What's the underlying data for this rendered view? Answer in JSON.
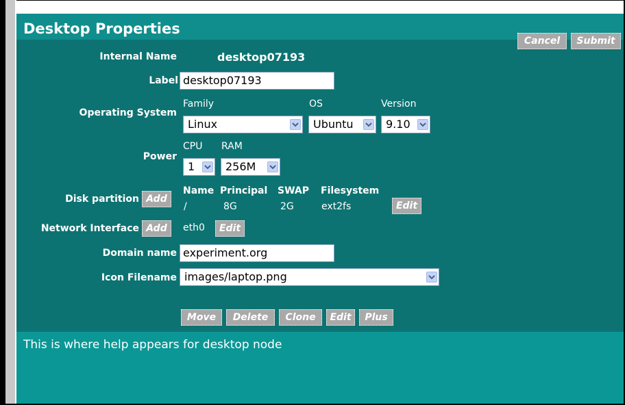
{
  "window": {
    "title": "Desktop Properties"
  },
  "toolbar": {
    "cancel_label": "Cancel",
    "submit_label": "Submit"
  },
  "fields": {
    "internal_name": {
      "label": "Internal Name",
      "value": "desktop07193"
    },
    "label": {
      "label": "Label",
      "value": "desktop07193"
    },
    "operating_system": {
      "label": "Operating System",
      "family": {
        "caption": "Family",
        "value": "Linux"
      },
      "os": {
        "caption": "OS",
        "value": "Ubuntu"
      },
      "version": {
        "caption": "Version",
        "value": "9.10"
      }
    },
    "power": {
      "label": "Power",
      "cpu": {
        "caption": "CPU",
        "value": "1"
      },
      "ram": {
        "caption": "RAM",
        "value": "256M"
      }
    },
    "disk_partition": {
      "label": "Disk partition",
      "add_label": "Add",
      "columns": [
        "Name",
        "Principal",
        "SWAP",
        "Filesystem"
      ],
      "rows": [
        {
          "name": "/",
          "principal": "8G",
          "swap": "2G",
          "filesystem": "ext2fs",
          "edit_label": "Edit"
        }
      ]
    },
    "network_interface": {
      "label": "Network Interface",
      "add_label": "Add",
      "items": [
        {
          "name": "eth0",
          "edit_label": "Edit"
        }
      ]
    },
    "domain_name": {
      "label": "Domain name",
      "value": "experiment.org"
    },
    "icon_filename": {
      "label": "Icon Filename",
      "value": "images/laptop.png"
    }
  },
  "actions": {
    "move": "Move",
    "delete": "Delete",
    "clone": "Clone",
    "edit": "Edit",
    "plus": "Plus"
  },
  "help": {
    "text": "This is where help appears for desktop node"
  },
  "colors": {
    "panel": "#0d7372",
    "header": "#0f8e8d",
    "help": "#0b9796",
    "button": "#a9a9a9",
    "frame_bar": "#c8c8c8"
  },
  "icons": {
    "select_arrow": "chevron-down-icon"
  }
}
